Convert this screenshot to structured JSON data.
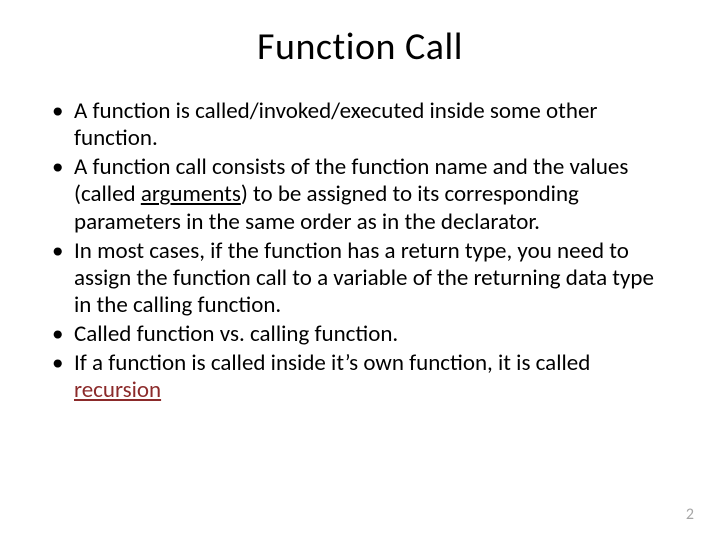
{
  "slide": {
    "title": "Function Call",
    "bullets": [
      {
        "pre": "A function is called/invoked/executed inside some other function.",
        "u": "",
        "post": ""
      },
      {
        "pre": "A function call consists of the function name and the values (called ",
        "u": "arguments",
        "post": ") to be assigned to its corresponding parameters in the same order as in the declarator."
      },
      {
        "pre": "In most cases, if the function has a return type, you need to assign the function call to a variable of the returning data type in the calling function.",
        "u": "",
        "post": ""
      },
      {
        "pre": "Called function vs. calling function.",
        "u": "",
        "post": ""
      },
      {
        "pre": "If a function is called inside it’s own function, it is called ",
        "u": "",
        "post": ""
      }
    ],
    "recursion_word": "recursion",
    "page_number": "2"
  }
}
